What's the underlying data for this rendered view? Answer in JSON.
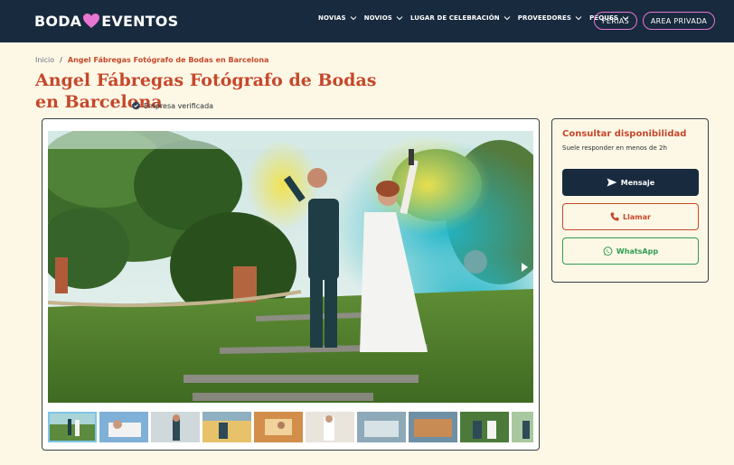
{
  "header": {
    "logo_left": "BODA",
    "logo_right": "EVENTOS",
    "nav": [
      {
        "label": "NOVIAS"
      },
      {
        "label": "NOVIOS"
      },
      {
        "label": "LUGAR DE CELEBRACIÓN"
      },
      {
        "label": "PROVEEDORES"
      },
      {
        "label": "PEQUES"
      }
    ],
    "ferias_label": "FERIAS",
    "area_label": "AREA PRIVADA"
  },
  "breadcrumb": {
    "home": "Inicio",
    "separator": "/",
    "current": "Angel Fábregas Fotógrafo de Bodas en Barcelona"
  },
  "page": {
    "title": "Angel Fábregas Fotógrafo de Bodas en Barcelona",
    "verified_label": "Empresa verificada"
  },
  "panel": {
    "title": "Consultar disponibilidad",
    "subtitle": "Suele responder en menos de 2h",
    "message_label": "Mensaje",
    "call_label": "Llamar",
    "whatsapp_label": "WhatsApp"
  },
  "colors": {
    "header_bg": "#182a3e",
    "accent": "#c5482b",
    "pink": "#e776d0",
    "whatsapp": "#2e9b4e",
    "page_bg": "#fdf8e6"
  },
  "icons": {
    "logo_heart": "heart-icon",
    "verified": "verified-badge-icon",
    "message": "send-icon",
    "call": "phone-icon",
    "whatsapp": "whatsapp-icon",
    "next": "chevron-right-icon"
  },
  "gallery": {
    "thumbnail_count": 10
  }
}
